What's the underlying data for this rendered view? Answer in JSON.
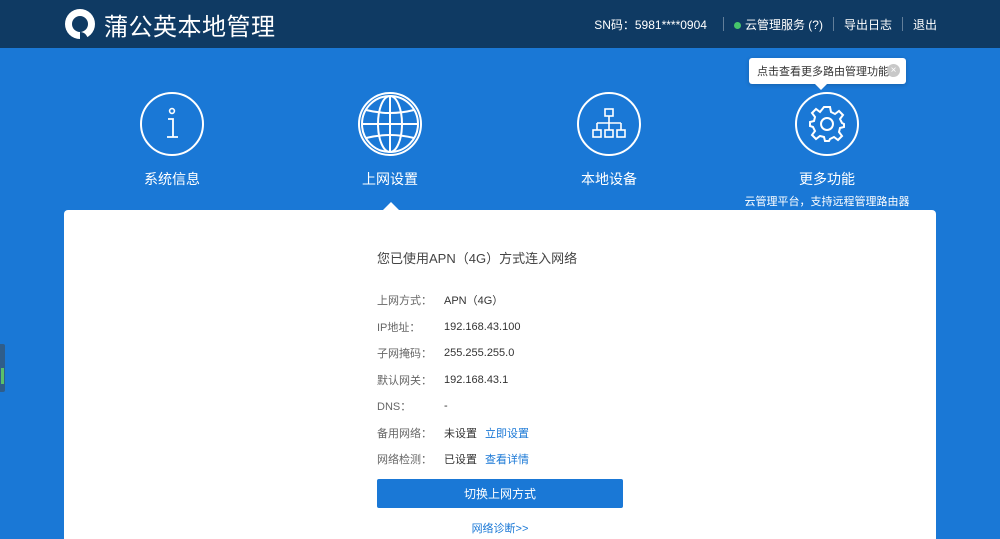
{
  "header": {
    "title": "蒲公英本地管理",
    "sn_text": "SN码：5981****0904",
    "cloud_service": "云管理服务 (?)",
    "export_log": "导出日志",
    "logout": "退出"
  },
  "tooltip": {
    "text": "点击查看更多路由管理功能",
    "close_glyph": "×"
  },
  "nav": [
    {
      "label": "系统信息",
      "icon": "info-icon"
    },
    {
      "label": "上网设置",
      "icon": "globe-icon",
      "active": true
    },
    {
      "label": "本地设备",
      "icon": "network-tree-icon"
    },
    {
      "label": "更多功能",
      "icon": "gear-icon",
      "sub": "云管理平台，支持远程管理路由器"
    }
  ],
  "network": {
    "status": "您已使用APN（4G）方式连入网络",
    "rows": [
      {
        "key": "上网方式：",
        "value": "APN（4G）"
      },
      {
        "key": "IP地址：",
        "value": "192.168.43.100"
      },
      {
        "key": "子网掩码：",
        "value": "255.255.255.0"
      },
      {
        "key": "默认网关：",
        "value": "192.168.43.1"
      },
      {
        "key": "DNS：",
        "value": "-"
      },
      {
        "key": "备用网络：",
        "value": "未设置",
        "link": "立即设置"
      },
      {
        "key": "网络检测：",
        "value": "已设置",
        "link": "查看详情"
      }
    ],
    "switch_button": "切换上网方式",
    "diagnose_link": "网络诊断>>"
  },
  "colors": {
    "topbar": "#0f3a63",
    "background": "#1a78d6",
    "accent": "#1a78d6",
    "status_online": "#46c56b"
  }
}
